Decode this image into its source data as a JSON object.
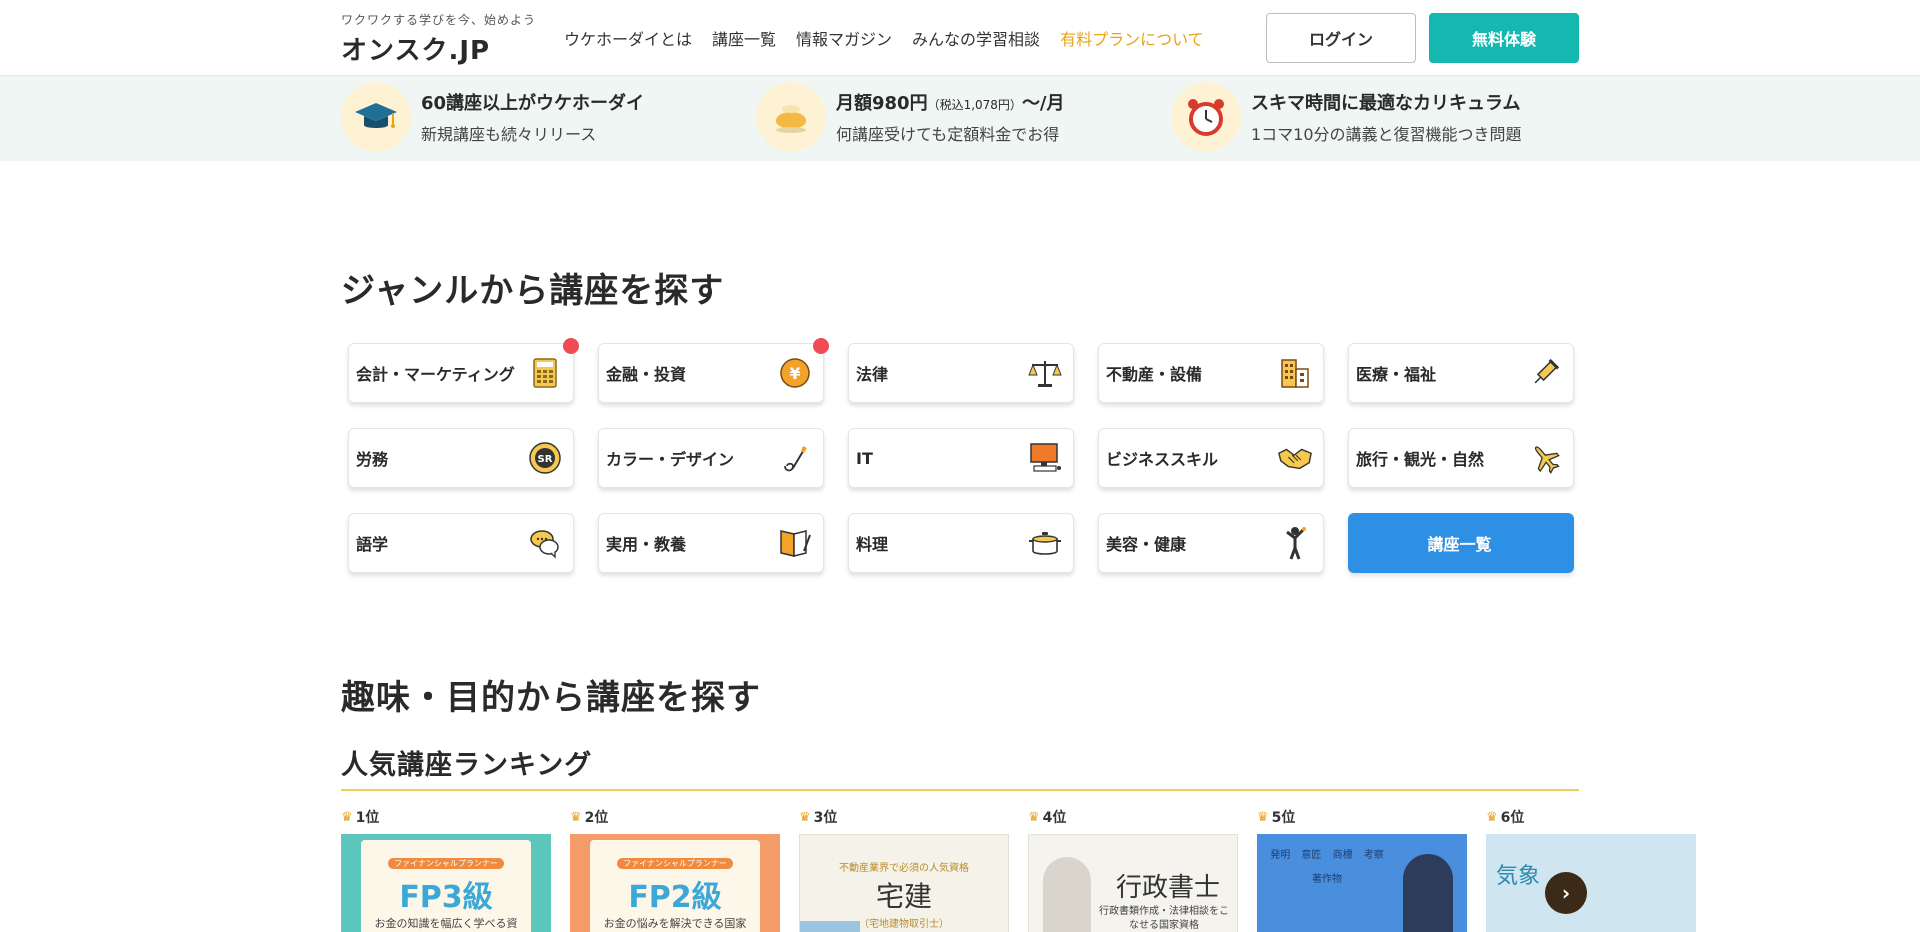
{
  "header": {
    "tagline": "ワクワクする学びを今、始めよう",
    "logo": "オンスク.JP",
    "nav": [
      "ウケホーダイとは",
      "講座一覧",
      "情報マガジン",
      "みんなの学習相談",
      "有料プランについて"
    ],
    "login": "ログイン",
    "trial": "無料体験"
  },
  "features": [
    {
      "icon": "graduation-cap-icon",
      "title": "60講座以上がウケホーダイ",
      "sub": "新規講座も続々リリース"
    },
    {
      "icon": "coin-purse-icon",
      "title_main": "月額980円",
      "title_small": "（税込1,078円）",
      "title_end": "～/月",
      "sub": "何講座受けても定額料金でお得"
    },
    {
      "icon": "alarm-clock-icon",
      "title": "スキマ時間に最適なカリキュラム",
      "sub": "1コマ10分の講義と復習機能つき問題"
    }
  ],
  "genre_section": {
    "title": "ジャンルから講座を探す",
    "items": [
      {
        "label": "会計・マーケティング",
        "icon": "calculator-icon",
        "new": true
      },
      {
        "label": "金融・投資",
        "icon": "yen-coin-icon",
        "new": true
      },
      {
        "label": "法律",
        "icon": "scales-icon",
        "new": false
      },
      {
        "label": "不動産・設備",
        "icon": "building-icon",
        "new": false
      },
      {
        "label": "医療・福祉",
        "icon": "syringe-icon",
        "new": false
      },
      {
        "label": "労務",
        "icon": "sr-badge-icon",
        "new": false
      },
      {
        "label": "カラー・デザイン",
        "icon": "brush-icon",
        "new": false
      },
      {
        "label": "IT",
        "icon": "computer-icon",
        "new": false
      },
      {
        "label": "ビジネススキル",
        "icon": "handshake-icon",
        "new": false
      },
      {
        "label": "旅行・観光・自然",
        "icon": "airplane-icon",
        "new": false
      },
      {
        "label": "語学",
        "icon": "speech-bubble-icon",
        "new": false
      },
      {
        "label": "実用・教養",
        "icon": "book-pen-icon",
        "new": false
      },
      {
        "label": "料理",
        "icon": "pot-icon",
        "new": false
      },
      {
        "label": "美容・健康",
        "icon": "exercise-icon",
        "new": false
      }
    ],
    "all_label": "講座一覧"
  },
  "purpose_section": {
    "title": "趣味・目的から講座を探す"
  },
  "ranking": {
    "title": "人気講座ランキング",
    "items": [
      {
        "rank": "1位",
        "course": "FP3級",
        "caption": "お金の知識を幅広く学べる資格",
        "badge": "ファイナンシャルプランナー",
        "bg": "#5dc7be"
      },
      {
        "rank": "2位",
        "course": "FP2級",
        "caption": "お金の悩みを解決できる国家資格",
        "badge": "ファイナンシャルプランナー",
        "bg": "#f59b6a"
      },
      {
        "rank": "3位",
        "course": "宅建",
        "caption": "（宅地建物取引士）",
        "badge": "不動産業界で必須の人気資格",
        "bg": "#f5f2e9"
      },
      {
        "rank": "4位",
        "course": "行政書士",
        "caption": "行政書類作成・法律相談をこなせる国家資格",
        "badge": "",
        "bg": "#f5f3ee"
      },
      {
        "rank": "5位",
        "course": "",
        "caption": "",
        "badge": "発明 意匠 商標 考察 著作物",
        "bg": "#4a8ede"
      },
      {
        "rank": "6位",
        "course": "気象",
        "caption": "",
        "badge": "",
        "bg": "#cfe6f0"
      }
    ]
  },
  "colors": {
    "accent_teal": "#14b8b0",
    "accent_blue": "#2e90e5",
    "highlight": "#e8a318",
    "new_dot": "#ef4b55"
  }
}
